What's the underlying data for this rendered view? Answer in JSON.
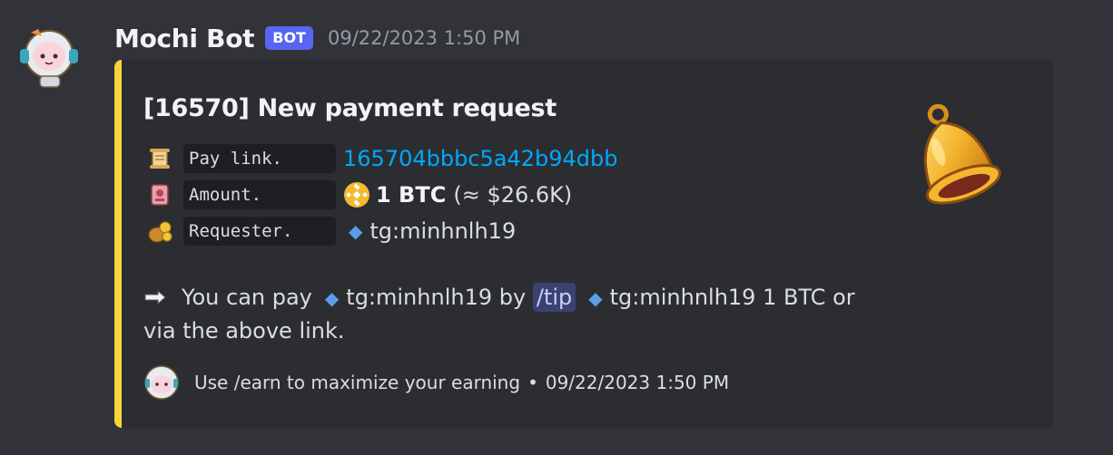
{
  "message": {
    "author": "Mochi Bot",
    "badge": "BOT",
    "timestamp": "09/22/2023 1:50 PM"
  },
  "embed": {
    "accent_color": "#f7d33f",
    "title": "[16570] New payment request",
    "thumbnail_icon": "bell-icon",
    "fields": {
      "pay_link_label": "Pay link.",
      "pay_link_value": "165704bbbc5a42b94dbb",
      "amount_label": "Amount.",
      "amount_value": "1 BTC",
      "amount_approx": "(≈ $26.6K)",
      "requester_label": "Requester.",
      "requester_value": "tg:minhnlh19"
    },
    "pay_instruction": {
      "prefix": "You can pay",
      "payee": "tg:minhnlh19",
      "by": "by",
      "command": "/tip",
      "tip_target": "tg:minhnlh19 1 BTC or",
      "suffix": "via the above link."
    },
    "footer": {
      "text": "Use /earn to maximize your earning",
      "separator": "•",
      "timestamp": "09/22/2023 1:50 PM"
    }
  },
  "icons": {
    "scroll": "scroll-icon",
    "amount": "ledger-icon",
    "requester": "money-bag-icon",
    "pointer": "pointing-hand-icon",
    "coin": "bnb-coin-icon",
    "diamond": "small-blue-diamond-icon"
  }
}
